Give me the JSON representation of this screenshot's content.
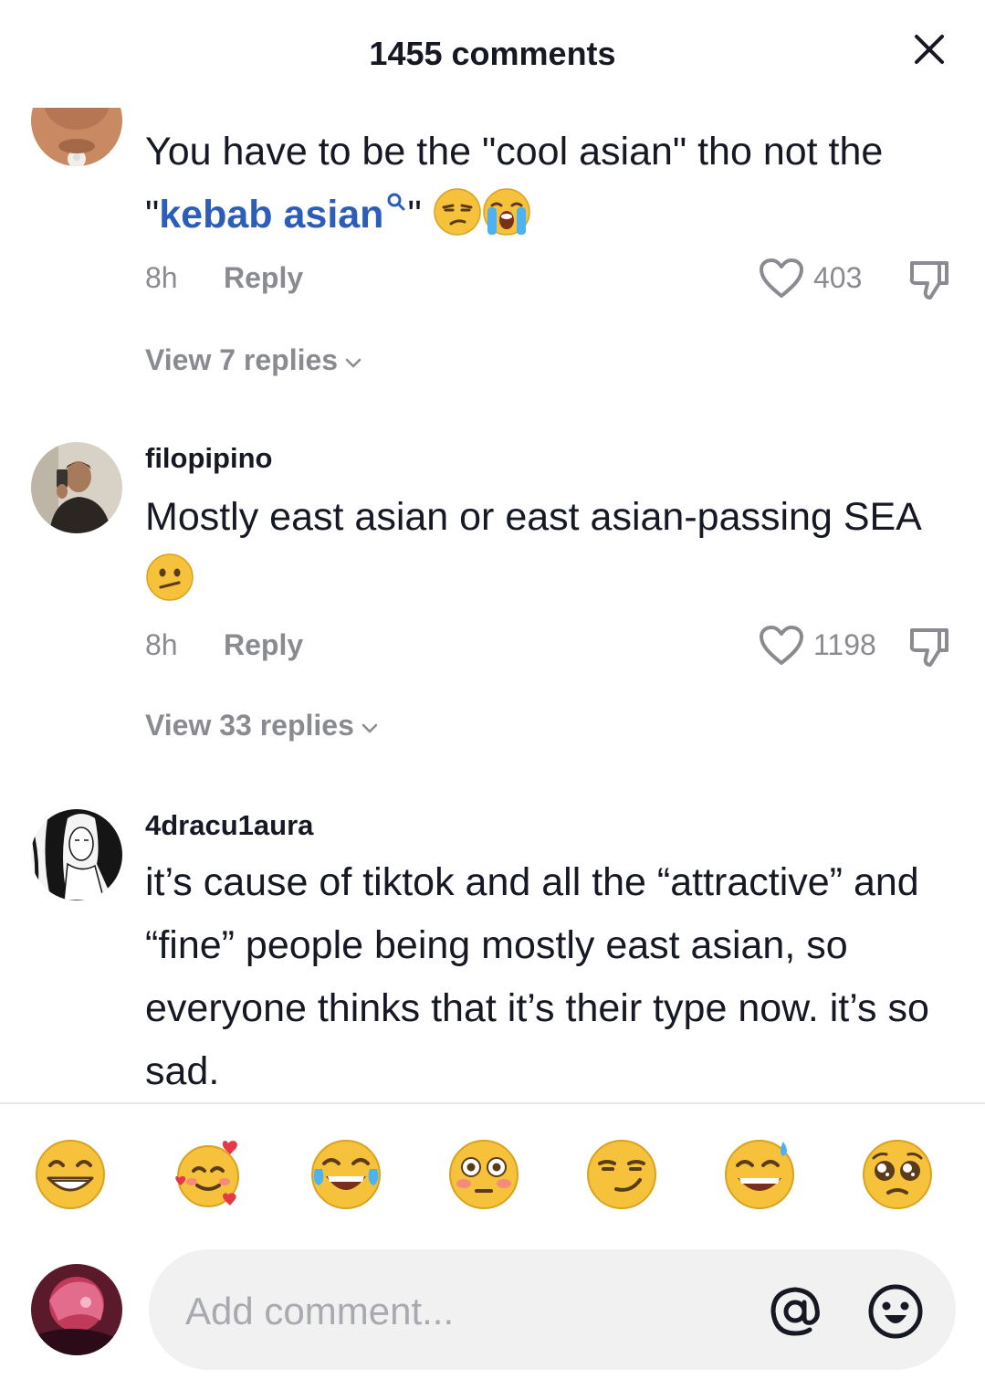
{
  "header": {
    "title": "1455 comments",
    "close_icon": "close-icon"
  },
  "comments": [
    {
      "avatar_icon": "user-avatar-photo",
      "text_before": "You have to be the \"cool asian\" tho not the \"",
      "keyword": "kebab asian",
      "text_after": "\" ",
      "emojis": [
        "unamused-face-emoji",
        "loudly-crying-face-emoji"
      ],
      "time": "8h",
      "reply_label": "Reply",
      "likes": "403",
      "view_replies": "View 7 replies"
    },
    {
      "username": "filopipino",
      "avatar_icon": "user-avatar-photo",
      "text": "Mostly east asian or east asian-passing SEA ",
      "emojis": [
        "face-with-diagonal-mouth-emoji"
      ],
      "time": "8h",
      "reply_label": "Reply",
      "likes": "1198",
      "view_replies": "View 33 replies"
    },
    {
      "username": "4dracu1aura",
      "avatar_icon": "user-avatar-drawing",
      "text": "it’s cause of tiktok and all the “attractive” and “fine” people being mostly east asian, so everyone thinks that it’s their type now. it’s so sad."
    }
  ],
  "emoji_bar": [
    "grinning-face-emoji",
    "smiling-face-with-hearts-emoji",
    "face-with-tears-of-joy-emoji",
    "flushed-face-emoji",
    "smirking-face-emoji",
    "grinning-face-with-sweat-emoji",
    "pleading-face-emoji"
  ],
  "composer": {
    "placeholder": "Add comment...",
    "mention_icon": "at-sign-icon",
    "emoji_icon": "smiley-face-icon"
  },
  "colors": {
    "text": "#161823",
    "secondary": "#8a8b91",
    "keyword": "#2b5db9",
    "input_bg": "#f1f1f2",
    "emoji_yellow": "#f6c23b"
  }
}
